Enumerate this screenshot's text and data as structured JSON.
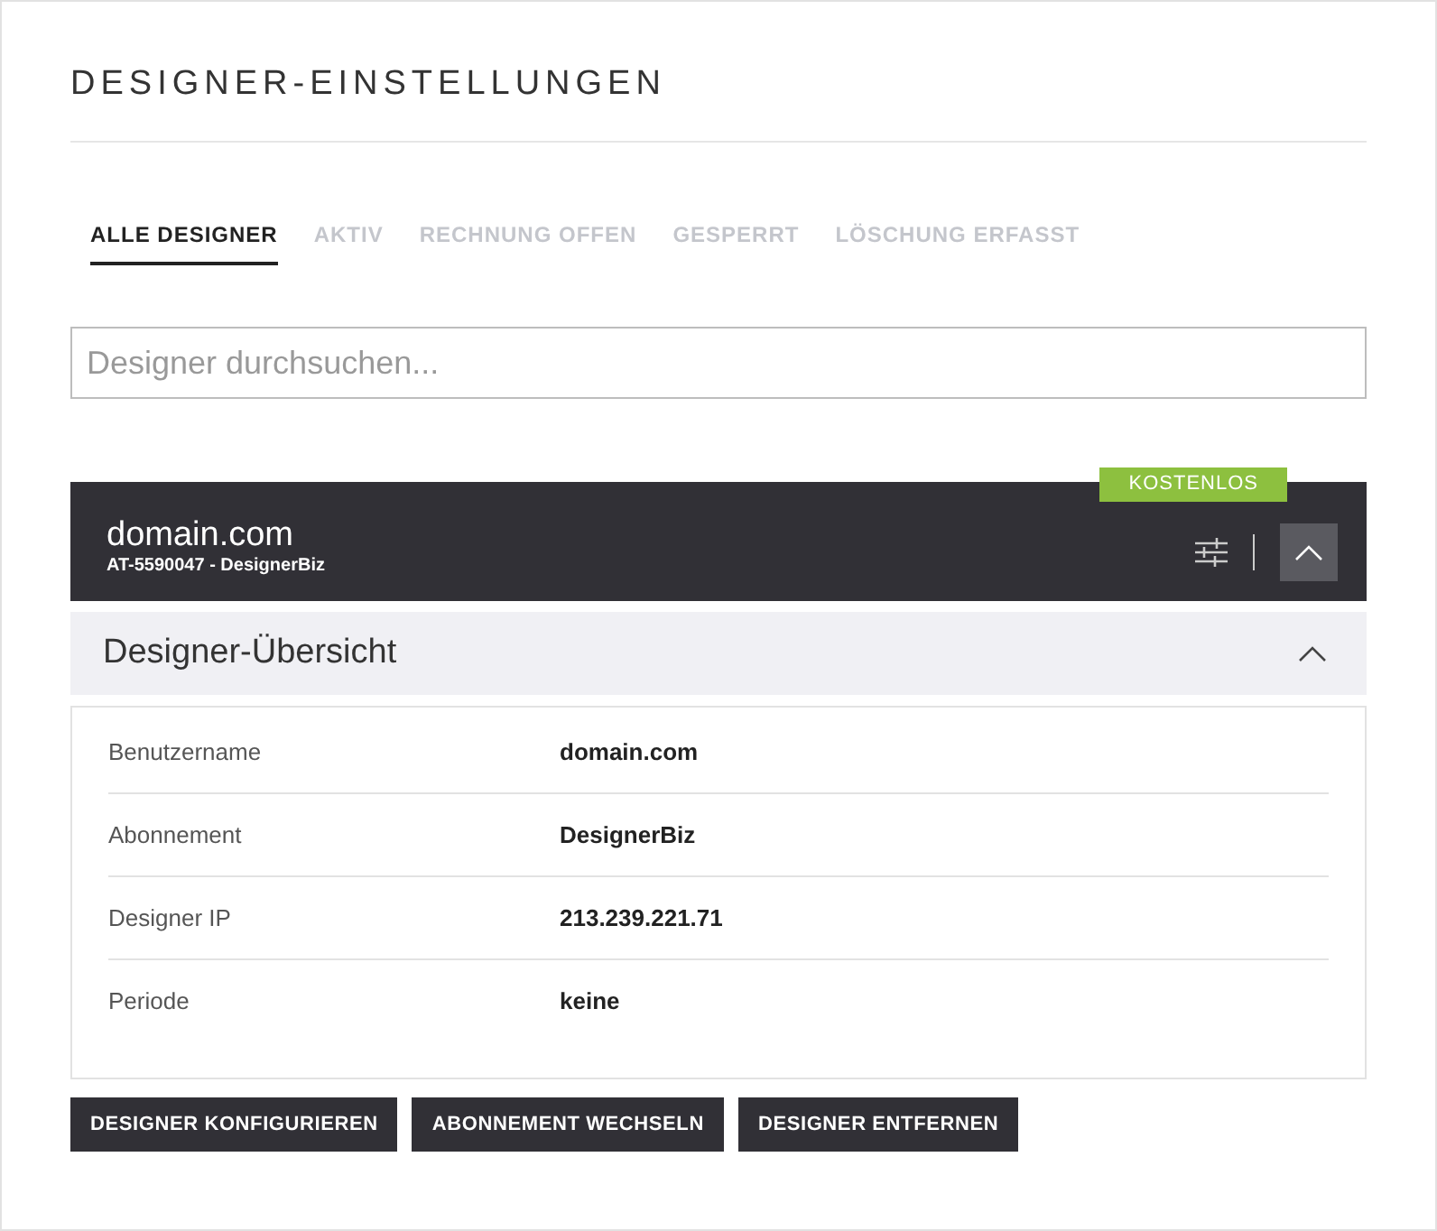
{
  "page": {
    "title": "DESIGNER-EINSTELLUNGEN"
  },
  "tabs": [
    {
      "label": "ALLE DESIGNER",
      "selected": true
    },
    {
      "label": "AKTIV",
      "selected": false
    },
    {
      "label": "RECHNUNG OFFEN",
      "selected": false
    },
    {
      "label": "GESPERRT",
      "selected": false
    },
    {
      "label": "LÖSCHUNG ERFASST",
      "selected": false
    }
  ],
  "search": {
    "placeholder": "Designer durchsuchen..."
  },
  "designer": {
    "name": "domain.com",
    "subtitle": "AT-5590047 - DesignerBiz",
    "badge": "KOSTENLOS",
    "expanded": true
  },
  "overview": {
    "title": "Designer-Übersicht",
    "expanded": true,
    "rows": [
      {
        "label": "Benutzername",
        "value": "domain.com"
      },
      {
        "label": "Abonnement",
        "value": "DesignerBiz"
      },
      {
        "label": "Designer IP",
        "value": "213.239.221.71"
      },
      {
        "label": "Periode",
        "value": "keine"
      }
    ]
  },
  "buttons": [
    "DESIGNER KONFIGURIEREN",
    "ABONNEMENT WECHSELN",
    "DESIGNER ENTFERNEN"
  ]
}
